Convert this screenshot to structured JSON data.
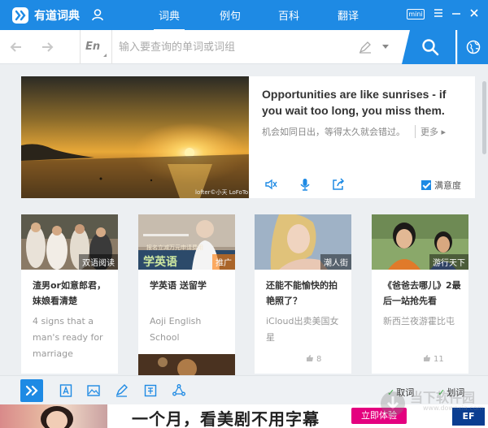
{
  "app": {
    "name": "有道词典"
  },
  "nav": {
    "tabs": [
      {
        "label": "词典"
      },
      {
        "label": "例句"
      },
      {
        "label": "百科"
      },
      {
        "label": "翻译"
      }
    ]
  },
  "window": {
    "mini_label": "mini"
  },
  "search": {
    "lang": "En",
    "placeholder": "输入要查询的单词或词组"
  },
  "daily": {
    "quote_en": "Opportunities are like sunrises - if you wait too long, you miss them.",
    "quote_cn": "机会如同日出，等得太久就会错过。",
    "more": "更多",
    "photo_credit": "lofter©小天 LoFoTo",
    "satisfaction": "满意度"
  },
  "feed": [
    {
      "tag": "双语阅读",
      "title": "渣男or如意郎君，妹娘看清楚",
      "subtitle": "4 signs that a man's ready for marriage",
      "likes": ""
    },
    {
      "tag": "推广",
      "title": "学英语 送留学",
      "subtitle": "Aoji English School",
      "likes": "",
      "banner_text": "学英语",
      "banner_caption": "报名立减万元申请费用"
    },
    {
      "tag": "潮人街",
      "title": "还能不能愉快的拍艳照了？",
      "subtitle": "iCloud出卖美国女星",
      "likes": "8"
    },
    {
      "tag": "游行天下",
      "title": "《爸爸去哪儿》2最后一站抢先看",
      "subtitle": "新西兰夜游霍比屯",
      "likes": "11"
    }
  ],
  "toolbar": {
    "options": [
      {
        "label": "取词"
      },
      {
        "label": "划词"
      }
    ]
  },
  "ad": {
    "text": "一个月，看美剧不用字幕",
    "cta": "立即体验",
    "logo": "EF"
  },
  "watermark": {
    "text": "当下软件园",
    "url": "www.downxia.com"
  },
  "colors": {
    "brand": "#1e8ae4",
    "accent_pink": "#e4007f",
    "check_green": "#2fae37"
  }
}
